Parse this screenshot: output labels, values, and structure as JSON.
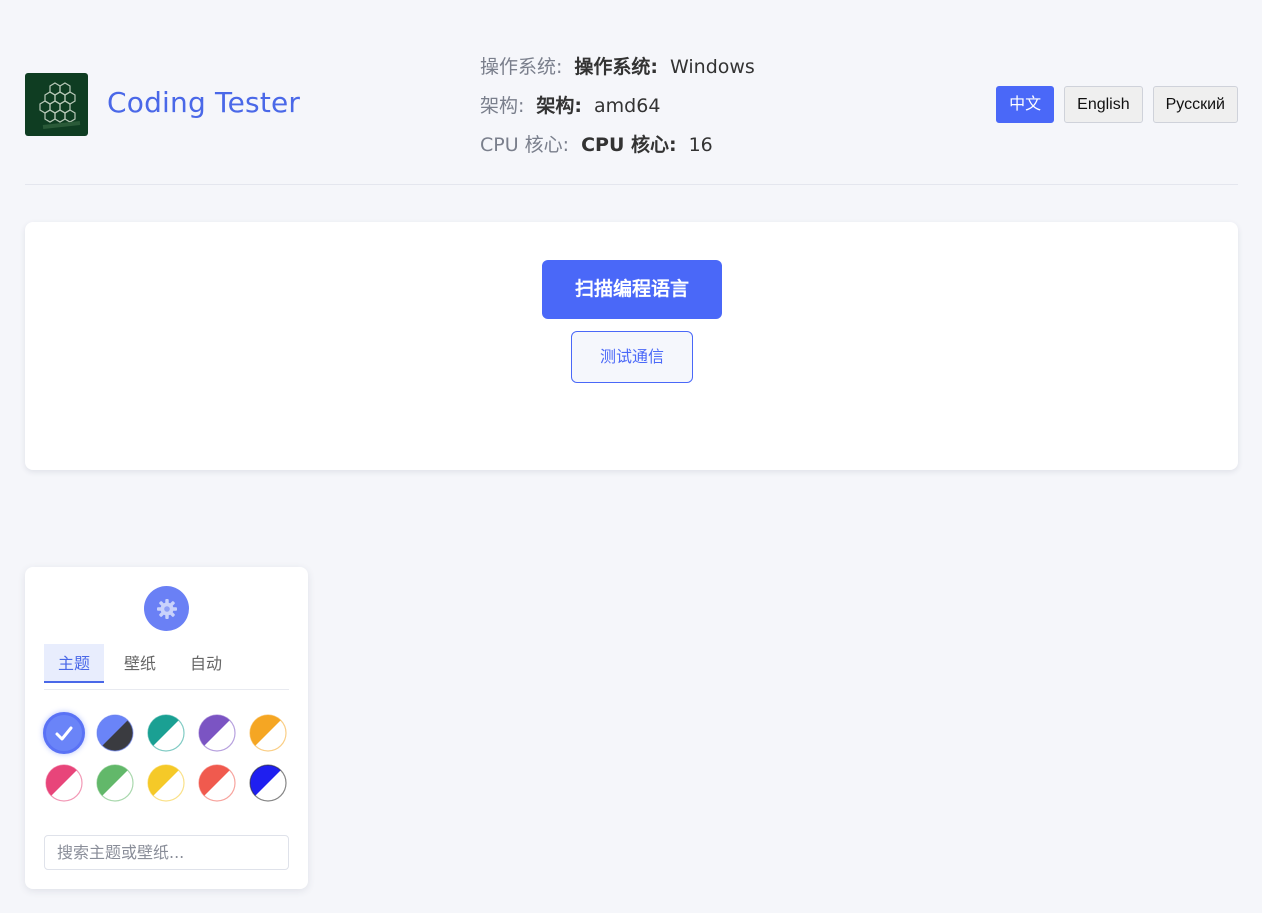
{
  "header": {
    "app_title": "Coding Tester",
    "logo_icon": "honeycomb-logo-icon"
  },
  "sysinfo": [
    {
      "label": "操作系统:",
      "label_bold": "操作系统:",
      "value": "Windows"
    },
    {
      "label": "架构:",
      "label_bold": "架构:",
      "value": "amd64"
    },
    {
      "label": "CPU 核心:",
      "label_bold": "CPU 核心:",
      "value": "16"
    }
  ],
  "languages": [
    {
      "label": "中文",
      "active": true
    },
    {
      "label": "English",
      "active": false
    },
    {
      "label": "Русский",
      "active": false
    }
  ],
  "main": {
    "scan_button": "扫描编程语言",
    "comm_button": "测试通信"
  },
  "theme_panel": {
    "gear_icon": "gear-icon",
    "tabs": [
      {
        "label": "主题",
        "active": true
      },
      {
        "label": "壁纸",
        "active": false
      },
      {
        "label": "自动",
        "active": false
      }
    ],
    "swatches": [
      {
        "name": "default-blue",
        "color_a": "#6a84f8",
        "color_b": "#6a84f8",
        "selected": true
      },
      {
        "name": "dark",
        "color_a": "#6a84f8",
        "color_b": "#3a3b40"
      },
      {
        "name": "teal",
        "color_a": "#1aa093",
        "color_b": "#ffffff"
      },
      {
        "name": "purple",
        "color_a": "#7b54c3",
        "color_b": "#ffffff"
      },
      {
        "name": "orange",
        "color_a": "#f5a623",
        "color_b": "#ffffff"
      },
      {
        "name": "pink",
        "color_a": "#e8457a",
        "color_b": "#ffffff"
      },
      {
        "name": "green",
        "color_a": "#62b86a",
        "color_b": "#ffffff"
      },
      {
        "name": "yellow",
        "color_a": "#f5c928",
        "color_b": "#ffffff"
      },
      {
        "name": "red",
        "color_a": "#f05a4e",
        "color_b": "#ffffff"
      },
      {
        "name": "contrast",
        "color_a": "#1f1ff0",
        "color_b": "#ffffff"
      }
    ],
    "search_placeholder": "搜索主题或壁纸..."
  },
  "colors": {
    "accent": "#4a68f8",
    "background": "#f5f6fa"
  }
}
